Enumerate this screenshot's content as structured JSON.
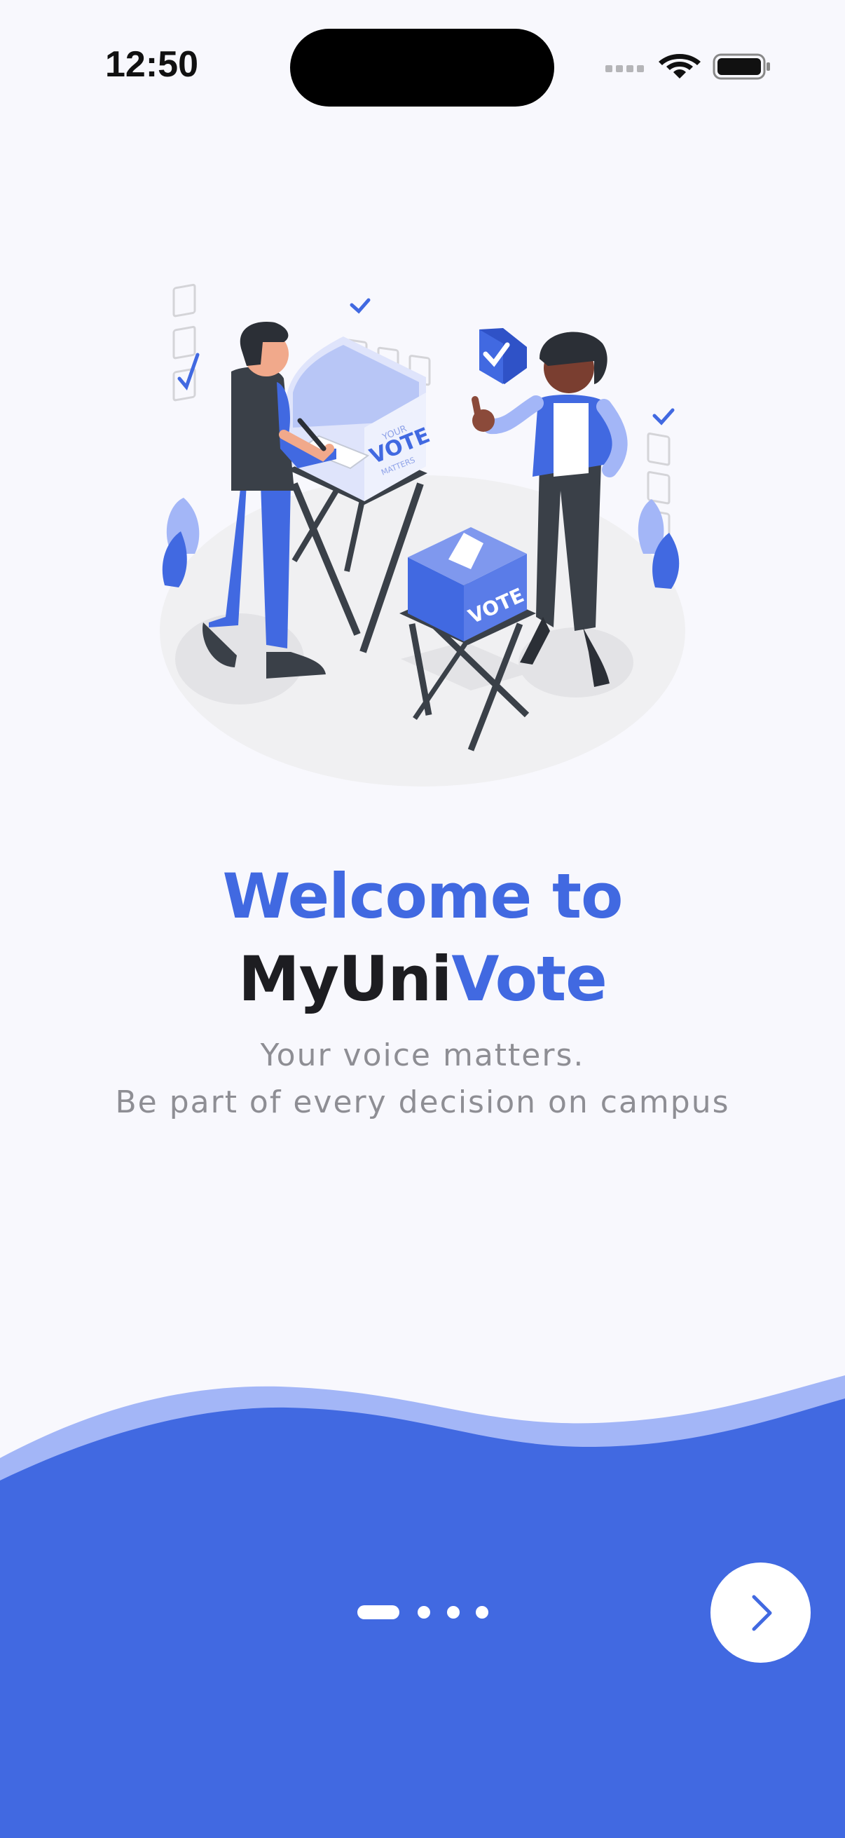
{
  "status_bar": {
    "time": "12:50"
  },
  "welcome": {
    "title_line1": "Welcome to",
    "title_brand_part1": "MyUni",
    "title_brand_part2": "Vote",
    "subtitle_line1": "Your voice matters.",
    "subtitle_line2": "Be part of every decision on campus"
  },
  "illustration": {
    "booth_text_top": "YOUR",
    "booth_text_main": "VOTE",
    "booth_text_bottom": "MATTERS",
    "ballot_box_text": "VOTE"
  },
  "pagination": {
    "total_pages": 4,
    "current_page": 1
  },
  "icons": {
    "next": "chevron-right-icon",
    "wifi": "wifi-icon",
    "battery": "battery-icon",
    "signal": "cellular-signal-icon"
  },
  "colors": {
    "primary": "#4169e1",
    "wave_light": "#a3b6f7",
    "background": "#f8f8fd",
    "dark_text": "#1d1d21",
    "subtitle_text": "#8e8e94"
  }
}
